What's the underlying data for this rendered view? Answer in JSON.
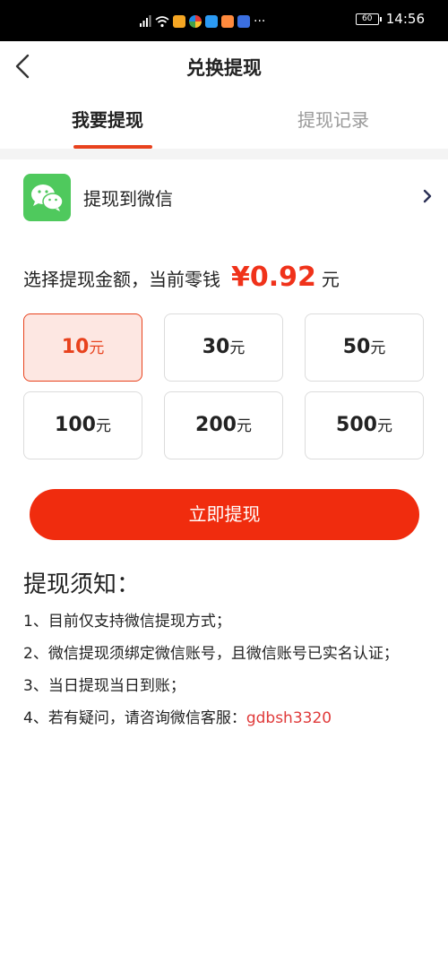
{
  "status_bar": {
    "battery": "60",
    "time": "14:56",
    "more": "···"
  },
  "header": {
    "title": "兑换提现"
  },
  "tabs": [
    {
      "label": "我要提现",
      "active": true
    },
    {
      "label": "提现记录",
      "active": false
    }
  ],
  "wechat": {
    "label": "提现到微信"
  },
  "amount": {
    "label": "选择提现金额，当前零钱",
    "value": "¥0.92",
    "unit": "元"
  },
  "options": [
    {
      "value": "10",
      "unit": "元",
      "selected": true
    },
    {
      "value": "30",
      "unit": "元"
    },
    {
      "value": "50",
      "unit": "元"
    },
    {
      "value": "100",
      "unit": "元"
    },
    {
      "value": "200",
      "unit": "元"
    },
    {
      "value": "500",
      "unit": "元"
    }
  ],
  "withdraw_button": "立即提现",
  "notes": {
    "title": "提现须知：",
    "items": [
      "1、目前仅支持微信提现方式；",
      "2、微信提现须绑定微信账号，且微信账号已实名认证；",
      "3、当日提现当日到账；",
      "4、若有疑问，请咨询微信客服："
    ],
    "contact": "gdbsh3320"
  },
  "colors": {
    "accent": "#f02c0e",
    "wechat_green": "#4fc95d",
    "selected_bg": "#fde7e2"
  }
}
